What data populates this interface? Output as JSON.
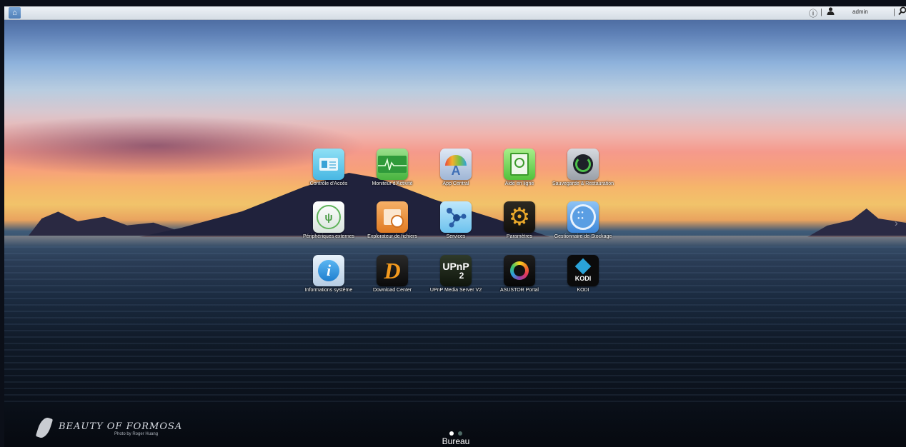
{
  "topbar": {
    "home_icon": "home-icon",
    "info_icon_glyph": "ⓘ",
    "separator": "|",
    "user_icon_glyph": "👤",
    "username": "admin",
    "search_icon_glyph": "⌕"
  },
  "apps": [
    {
      "label": "Contrôle d'Accès",
      "icon": "access-control-icon"
    },
    {
      "label": "Moniteur d'Activité",
      "icon": "activity-monitor-icon"
    },
    {
      "label": "App Central",
      "icon": "app-central-icon"
    },
    {
      "label": "Aide en ligne",
      "icon": "online-help-icon"
    },
    {
      "label": "Sauvegarde & Restauration",
      "icon": "backup-restore-icon"
    },
    {
      "label": "Périphériques externes",
      "icon": "external-devices-icon"
    },
    {
      "label": "Explorateur de fichiers",
      "icon": "file-explorer-icon"
    },
    {
      "label": "Services",
      "icon": "services-icon"
    },
    {
      "label": "Paramètres",
      "icon": "settings-gear-icon"
    },
    {
      "label": "Gestionnaire de Stockage",
      "icon": "storage-manager-icon"
    },
    {
      "label": "Informations système",
      "icon": "system-info-icon"
    },
    {
      "label": "Download Center",
      "icon": "download-center-icon"
    },
    {
      "label": "UPnP Media Server V2",
      "icon": "upnp-media-server-icon",
      "icon_text_1": "UPnP",
      "icon_text_2": "2"
    },
    {
      "label": "ASUSTOR Portal",
      "icon": "asustor-portal-icon"
    },
    {
      "label": "KODI",
      "icon": "kodi-icon",
      "icon_text": "KODI"
    }
  ],
  "desktop": {
    "page_count": 2,
    "current_page": 1,
    "name": "Bureau"
  },
  "wallpaper": {
    "brand": "BEAUTY OF FORMOSA",
    "credit": "Photo by Roger Huang"
  },
  "colors": {
    "topbar": "#e3e9ef",
    "label_text": "#ffffff"
  }
}
